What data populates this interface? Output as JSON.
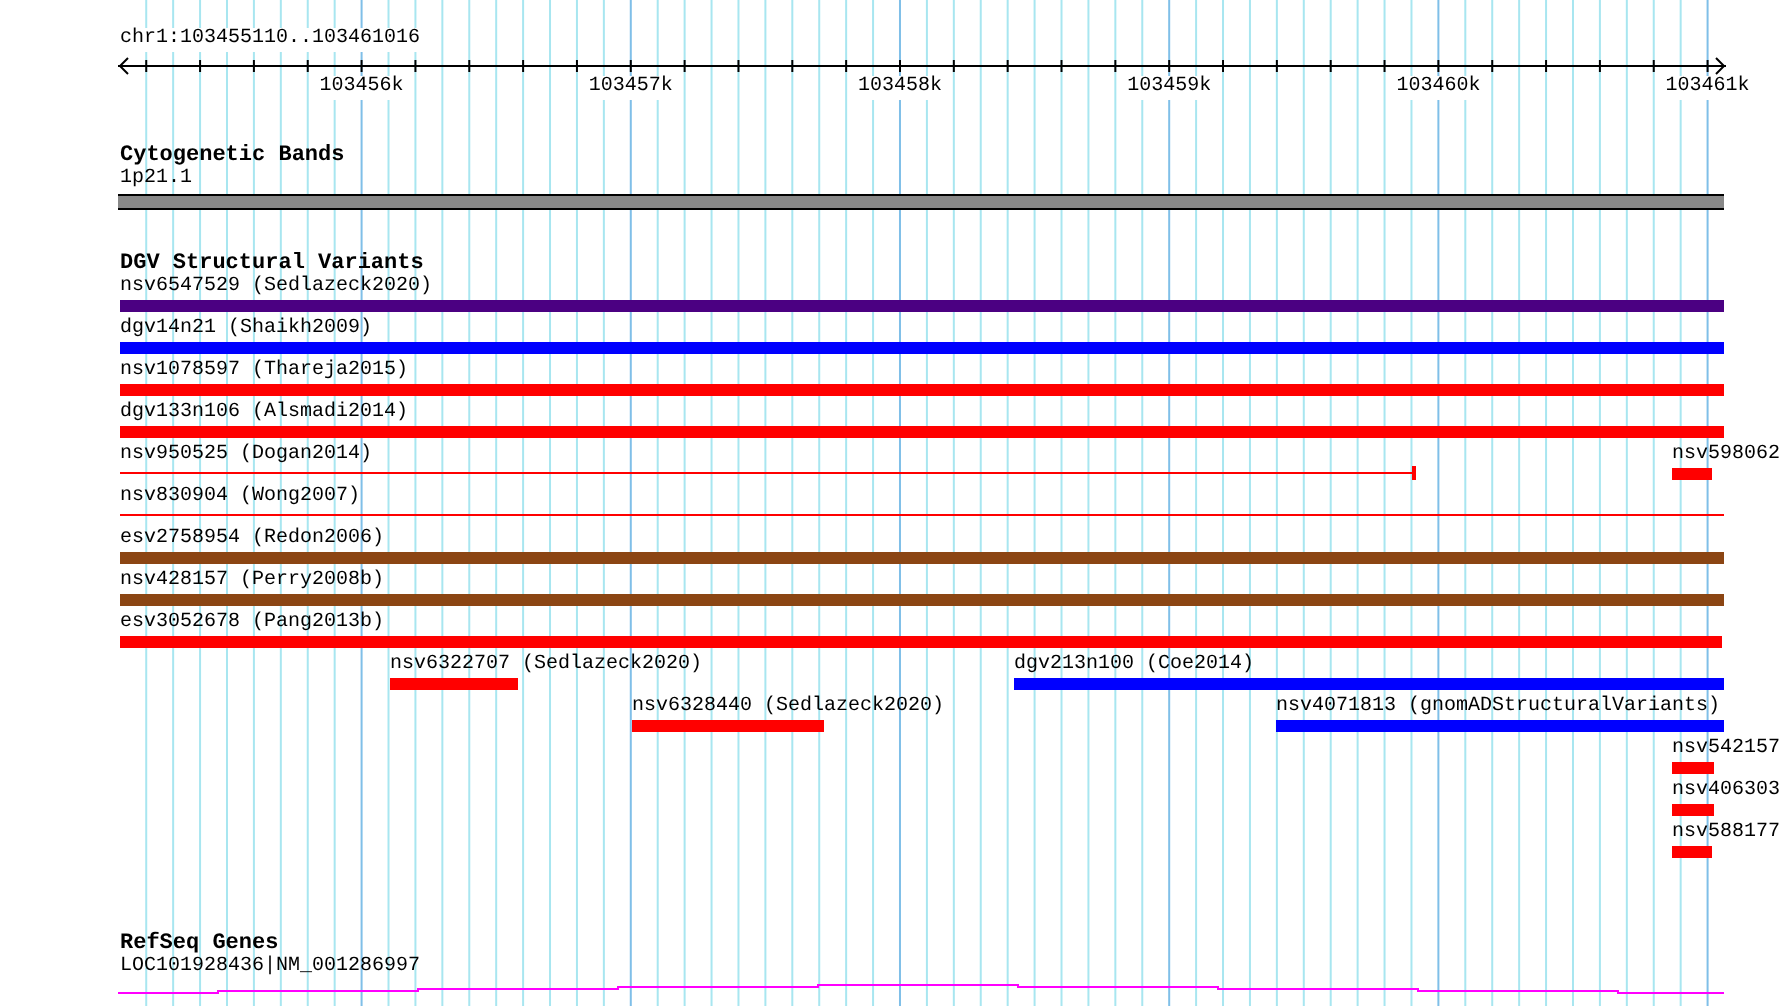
{
  "location": "chr1:103455110..103461016",
  "ruler": {
    "ticks": [
      "103456k",
      "103457k",
      "103458k",
      "103459k",
      "103460k",
      "103461k"
    ]
  },
  "cytogenetic_bands": {
    "title": "Cytogenetic Bands",
    "band": {
      "label": "1p21.1"
    }
  },
  "dgv": {
    "title": "DGV Structural Variants",
    "rows": [
      {
        "features": [
          {
            "label": "nsv6547529 (Sedlazeck2020)",
            "kind": "bar",
            "color": "#4b0082"
          }
        ]
      },
      {
        "features": [
          {
            "label": "dgv14n21 (Shaikh2009)",
            "kind": "bar",
            "color": "#0000ff"
          }
        ]
      },
      {
        "features": [
          {
            "label": "nsv1078597 (Thareja2015)",
            "kind": "bar",
            "color": "#ff0000"
          }
        ]
      },
      {
        "features": [
          {
            "label": "dgv133n106 (Alsmadi2014)",
            "kind": "bar",
            "color": "#ff0000"
          }
        ]
      },
      {
        "features": [
          {
            "label": "nsv950525 (Dogan2014)",
            "kind": "line",
            "color": "#ff0000"
          },
          {
            "label": "nsv598062",
            "kind": "bar",
            "color": "#ff0000"
          }
        ]
      },
      {
        "features": [
          {
            "label": "nsv830904 (Wong2007)",
            "kind": "line",
            "color": "#ff0000"
          }
        ]
      },
      {
        "features": [
          {
            "label": "esv2758954 (Redon2006)",
            "kind": "bar",
            "color": "#8b4513"
          }
        ]
      },
      {
        "features": [
          {
            "label": "nsv428157 (Perry2008b)",
            "kind": "bar",
            "color": "#8b4513"
          }
        ]
      },
      {
        "features": [
          {
            "label": "esv3052678 (Pang2013b)",
            "kind": "bar",
            "color": "#ff0000"
          }
        ]
      },
      {
        "features": [
          {
            "label": "nsv6322707 (Sedlazeck2020)",
            "kind": "bar",
            "color": "#ff0000"
          },
          {
            "label": "dgv213n100 (Coe2014)",
            "kind": "bar",
            "color": "#0000ff"
          }
        ]
      },
      {
        "features": [
          {
            "label": "nsv6328440 (Sedlazeck2020)",
            "kind": "bar",
            "color": "#ff0000"
          },
          {
            "label": "nsv4071813 (gnomADStructuralVariants)",
            "kind": "bar",
            "color": "#0000ff"
          }
        ]
      },
      {
        "features": [
          {
            "label": "nsv542157",
            "kind": "bar",
            "color": "#ff0000"
          }
        ]
      },
      {
        "features": [
          {
            "label": "nsv406303",
            "kind": "bar",
            "color": "#ff0000"
          }
        ]
      },
      {
        "features": [
          {
            "label": "nsv588177",
            "kind": "bar",
            "color": "#ff0000"
          }
        ]
      }
    ]
  },
  "refseq": {
    "title": "RefSeq Genes",
    "gene": {
      "label": "LOC101928436|NM_001286997"
    }
  }
}
